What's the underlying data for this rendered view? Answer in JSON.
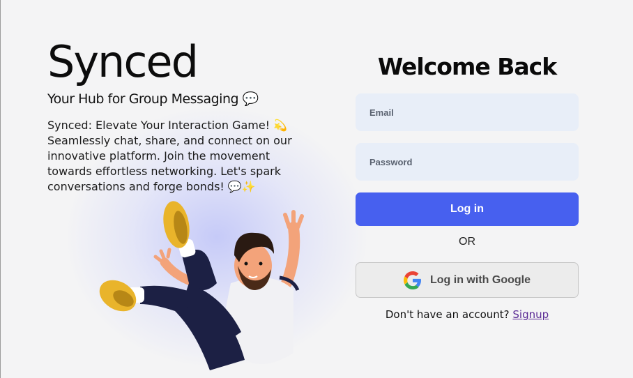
{
  "brand": {
    "name": "Synced",
    "tagline": "Your Hub for Group Messaging 💬",
    "description": "Synced: Elevate Your Interaction Game! 💫 Seamlessly chat, share, and connect on our innovative platform. Join the movement towards effortless networking. Let's spark conversations and forge bonds! 💬✨"
  },
  "login": {
    "title": "Welcome Back",
    "email_placeholder": "Email",
    "password_placeholder": "Password",
    "login_label": "Log in",
    "or_text": "OR",
    "google_label": "Log in with Google",
    "signup_prompt": "Don't have an account?",
    "signup_link": "Signup"
  },
  "colors": {
    "primary": "#4760ef",
    "field_bg": "#e8eef8",
    "link": "#5b2b95"
  },
  "icons": {
    "google": "google-g-icon"
  }
}
